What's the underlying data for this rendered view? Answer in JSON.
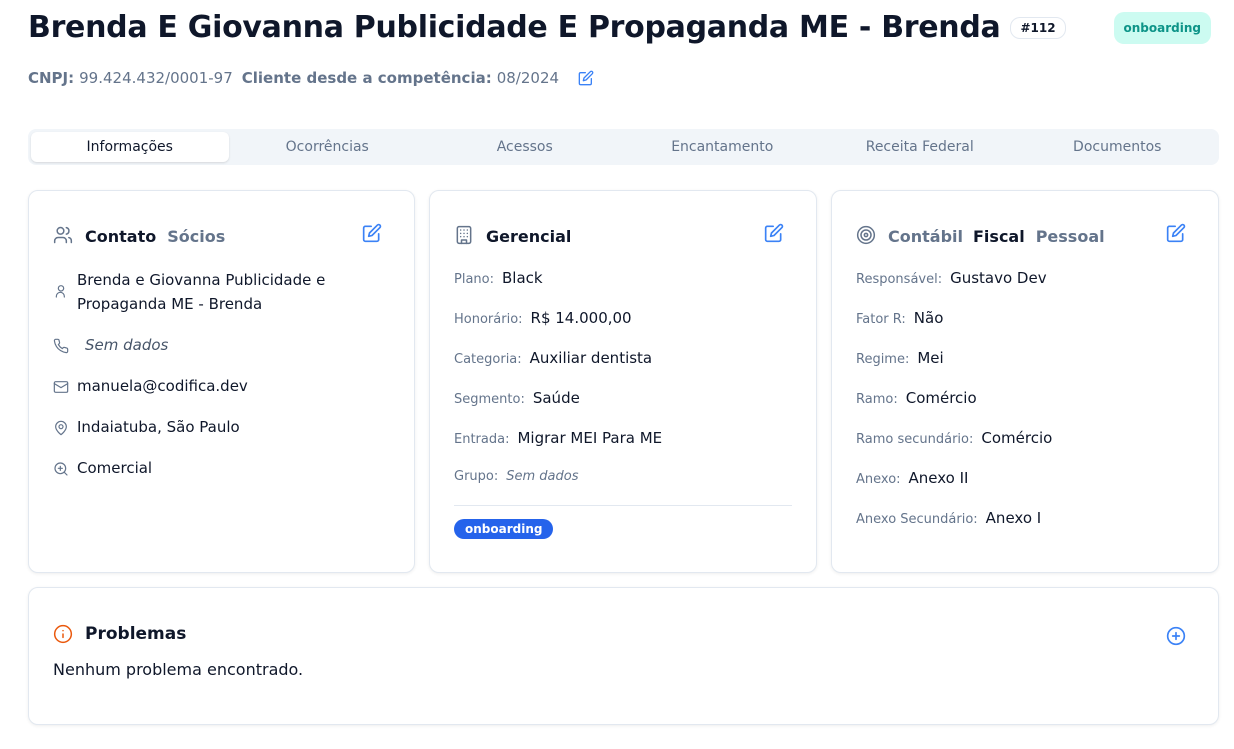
{
  "header": {
    "title": "Brenda E Giovanna Publicidade E Propaganda ME - Brenda",
    "id_badge": "#112",
    "status": "onboarding",
    "cnpj_label": "CNPJ:",
    "cnpj_value": "99.424.432/0001-97",
    "client_since_label": "Cliente desde a competência:",
    "client_since_value": "08/2024"
  },
  "tabs": [
    {
      "label": "Informações",
      "active": true
    },
    {
      "label": "Ocorrências",
      "active": false
    },
    {
      "label": "Acessos",
      "active": false
    },
    {
      "label": "Encantamento",
      "active": false
    },
    {
      "label": "Receita Federal",
      "active": false
    },
    {
      "label": "Documentos",
      "active": false
    }
  ],
  "contact_card": {
    "tab_active": "Contato",
    "tab_other": "Sócios",
    "name": "Brenda e Giovanna Publicidade e Propaganda ME - Brenda",
    "phone": "Sem dados",
    "email": "manuela@codifica.dev",
    "location": "Indaiatuba, São Paulo",
    "source": "Comercial",
    "icons": {
      "header": "users-icon",
      "name": "user-icon",
      "phone": "phone-icon",
      "email": "mail-icon",
      "location": "map-pin-icon",
      "source": "zoom-in-icon"
    }
  },
  "management_card": {
    "title": "Gerencial",
    "rows": [
      {
        "label": "Plano:",
        "value": "Black"
      },
      {
        "label": "Honorário:",
        "value": "R$ 14.000,00"
      },
      {
        "label": "Categoria:",
        "value": "Auxiliar dentista"
      },
      {
        "label": "Segmento:",
        "value": "Saúde"
      },
      {
        "label": "Entrada:",
        "value": "Migrar MEI Para ME"
      },
      {
        "label": "Grupo:",
        "value": "Sem dados"
      }
    ],
    "tag": "onboarding"
  },
  "fiscal_card": {
    "tab_contabil": "Contábil",
    "tab_fiscal": "Fiscal",
    "tab_pessoal": "Pessoal",
    "rows": [
      {
        "label": "Responsável:",
        "value": "Gustavo Dev"
      },
      {
        "label": "Fator R:",
        "value": "Não"
      },
      {
        "label": "Regime:",
        "value": "Mei"
      },
      {
        "label": "Ramo:",
        "value": "Comércio"
      },
      {
        "label": "Ramo secundário:",
        "value": "Comércio"
      },
      {
        "label": "Anexo:",
        "value": "Anexo II"
      },
      {
        "label": "Anexo Secundário:",
        "value": "Anexo I"
      }
    ]
  },
  "problems": {
    "title": "Problemas",
    "empty_text": "Nenhum problema encontrado."
  },
  "colors": {
    "accent": "#3b82f6",
    "status_bg": "#ccfbf1",
    "status_text": "#0d9488",
    "tag_bg": "#2563eb",
    "warning": "#ea580c"
  }
}
